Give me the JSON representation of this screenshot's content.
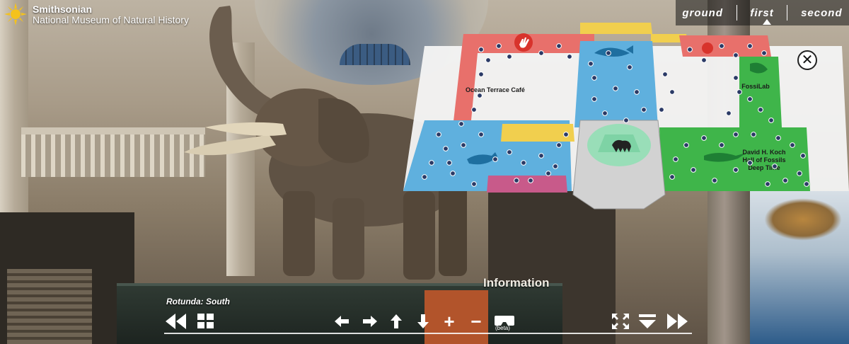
{
  "logo": {
    "line1": "Smithsonian",
    "line2": "National Museum of Natural History"
  },
  "floor_tabs": [
    {
      "label": "ground",
      "active": false
    },
    {
      "label": "first",
      "active": true
    },
    {
      "label": "second",
      "active": false
    }
  ],
  "map": {
    "labels": {
      "cafe": "Ocean Terrace Café",
      "fossilab": "FossiLab",
      "fossil_hall_1": "David H. Koch",
      "fossil_hall_2": "Hall of Fossils",
      "fossil_hall_3": "Deep Time"
    },
    "close_symbol": "✕",
    "colors": {
      "red_wing": "#e8706b",
      "blue_hall": "#5fb0de",
      "green_hall": "#3fb54a",
      "yellow_corridor": "#f1cf4e",
      "pink_hall": "#c85a8a",
      "rotunda": "#cfcfcf"
    }
  },
  "toolbar": {
    "location": "Rotunda: South",
    "beta_label": "(beta)",
    "buttons": [
      "rewind-icon",
      "grid-icon",
      "arrow-left-icon",
      "arrow-right-icon",
      "arrow-up-icon",
      "arrow-down-icon",
      "zoom-in-icon",
      "zoom-out-icon",
      "vr-headset-icon",
      "fullscreen-icon",
      "hide-toolbar-icon",
      "fast-forward-icon"
    ],
    "zoom_in_symbol": "+",
    "zoom_out_symbol": "−"
  },
  "scene": {
    "sign_text": "Information"
  }
}
